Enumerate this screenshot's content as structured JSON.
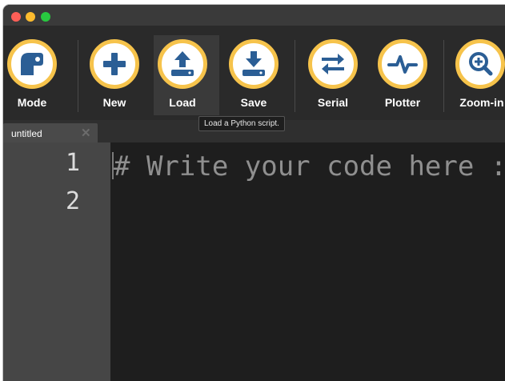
{
  "toolbar": {
    "items": [
      {
        "label": "Mode",
        "icon": "mode-icon"
      },
      {
        "label": "New",
        "icon": "plus-icon"
      },
      {
        "label": "Load",
        "icon": "upload-icon"
      },
      {
        "label": "Save",
        "icon": "download-icon"
      },
      {
        "label": "Serial",
        "icon": "swap-arrows-icon"
      },
      {
        "label": "Plotter",
        "icon": "pulse-icon"
      },
      {
        "label": "Zoom-in",
        "icon": "zoom-in-icon"
      }
    ],
    "tooltip": "Load a Python script."
  },
  "tabs": [
    {
      "title": "untitled",
      "close": "✕"
    }
  ],
  "editor": {
    "line_numbers": [
      "1",
      "2"
    ],
    "lines": [
      "# Write your code here :-)"
    ]
  },
  "colors": {
    "accent_ring": "#f6c34b",
    "icon_blue": "#2b5e95",
    "toolbar_bg": "#2a2a2a",
    "editor_bg": "#1e1e1e",
    "gutter_bg": "#464646"
  }
}
